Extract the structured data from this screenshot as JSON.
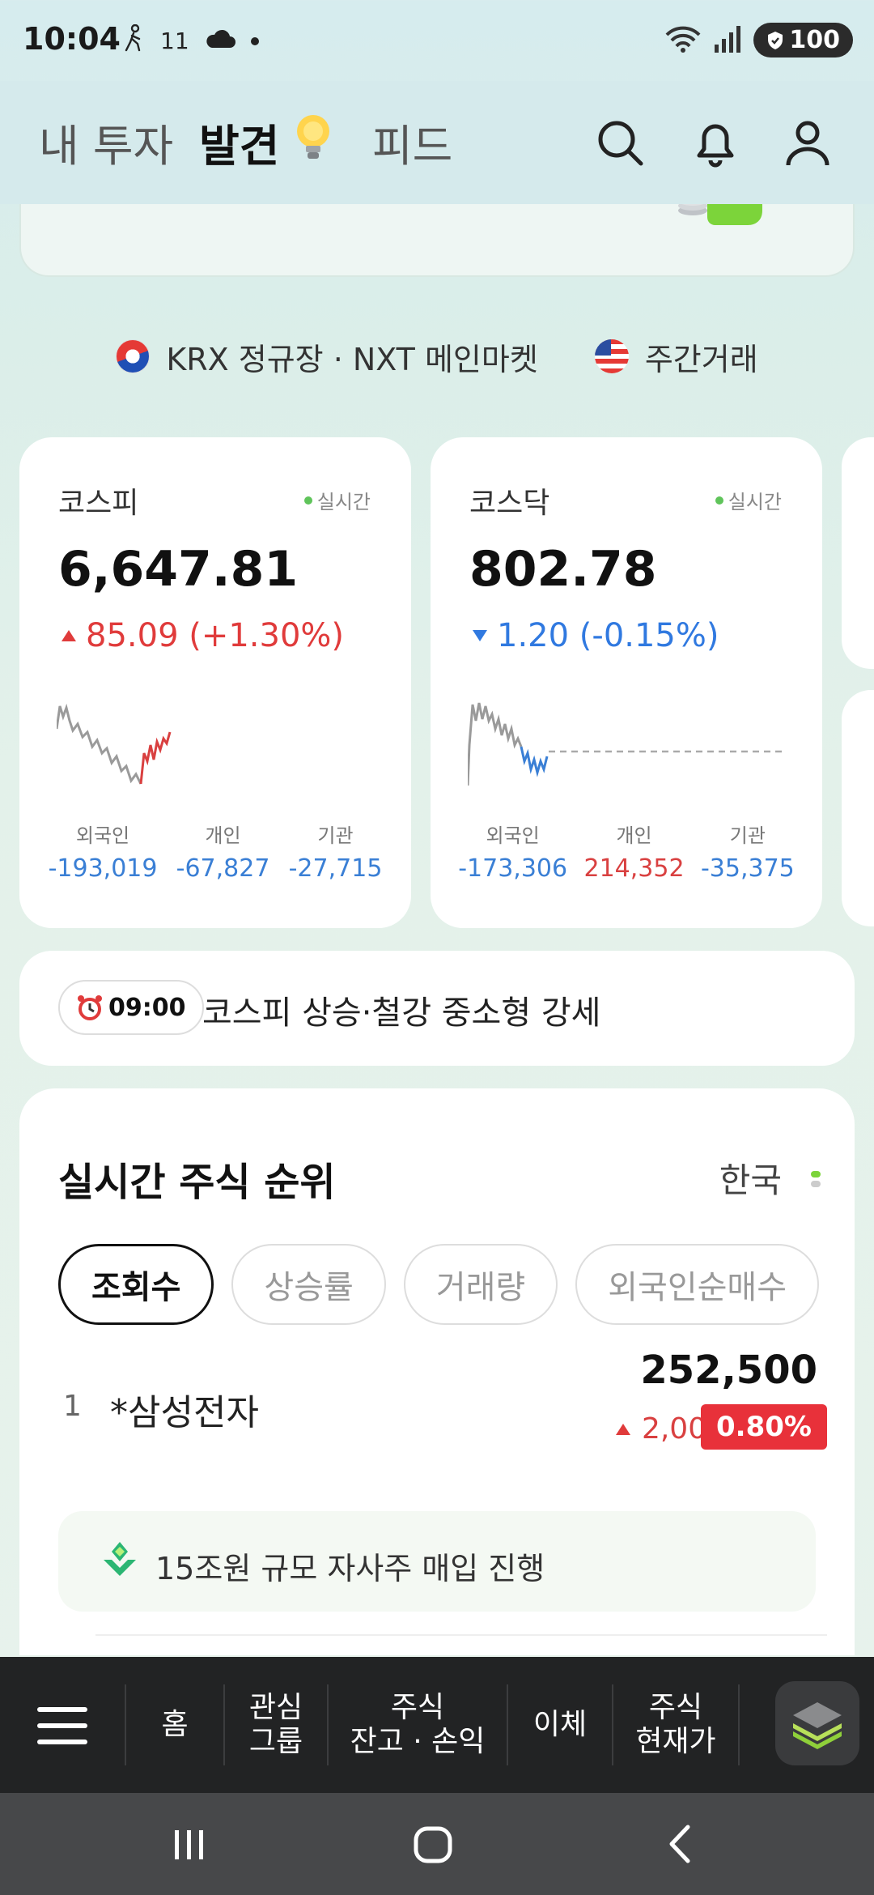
{
  "status": {
    "time": "10:04",
    "notif_text": "11",
    "battery": "100"
  },
  "topnav": {
    "tabs": [
      {
        "label": "내 투자"
      },
      {
        "label": "발견"
      },
      {
        "label": "피드"
      }
    ]
  },
  "market": {
    "kr_label": "KRX 정규장 · NXT 메인마켓",
    "us_label": "주간거래"
  },
  "indices": [
    {
      "name": "코스피",
      "live": "실시간",
      "value": "6,647.81",
      "change": "85.09 (+1.30%)",
      "direction": "up",
      "investors": [
        {
          "label": "외국인",
          "value": "-193,019"
        },
        {
          "label": "개인",
          "value": "-67,827"
        },
        {
          "label": "기관",
          "value": "-27,715"
        }
      ]
    },
    {
      "name": "코스닥",
      "live": "실시간",
      "value": "802.78",
      "change": "1.20 (-0.15%)",
      "direction": "down",
      "investors": [
        {
          "label": "외국인",
          "value": "-173,306"
        },
        {
          "label": "개인",
          "value": "214,352"
        },
        {
          "label": "기관",
          "value": "-35,375"
        }
      ]
    }
  ],
  "news": {
    "time": "09:00",
    "text": "코스피 상승·철강 중소형 강세"
  },
  "ranking": {
    "title": "실시간 주식 순위",
    "region": "한국",
    "chips": [
      "조회수",
      "상승률",
      "거래량",
      "외국인순매수"
    ],
    "rows": [
      {
        "rank": "1",
        "name": "*삼성전자",
        "price": "252,500",
        "change": "2,000",
        "pct": "0.80%"
      }
    ],
    "insight": "15조원 규모 자사주 매입 진행"
  },
  "bottomnav": {
    "home": "홈",
    "watch_l1": "관심",
    "watch_l2": "그룹",
    "stock_l1": "주식",
    "stock_l2": "잔고 · 손익",
    "transfer": "이체",
    "price_l1": "주식",
    "price_l2": "현재가"
  },
  "colors": {
    "up": "#e03b3b",
    "down": "#3079e0",
    "accent_green": "#5fc45a"
  }
}
